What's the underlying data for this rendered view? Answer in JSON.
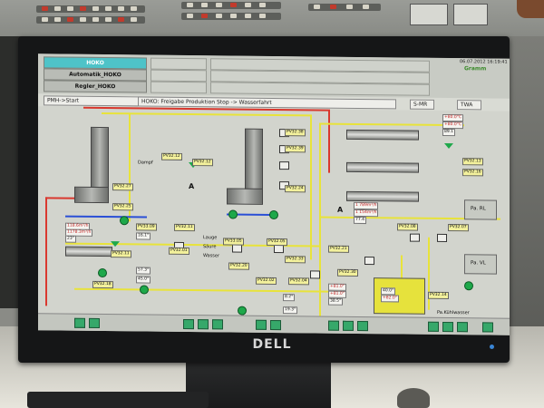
{
  "monitor": {
    "brand": "DELL"
  },
  "hmi": {
    "nav": [
      "HOKO",
      "Automatik_HOKO",
      "Regler_HOKO"
    ],
    "status_left": "PMH->Start",
    "status_main": "HOKO: Freigabe Produktion Stop  -> Wasserfahrt",
    "status_right1": "S-MR",
    "status_right2": "TWA",
    "timestamp": "06.07.2012 16:19:41",
    "logo": "Gramm",
    "tags": [
      "PV32.12",
      "PV32.12",
      "PV32.27",
      "PV32.25",
      "PV32.38",
      "PV32.39",
      "PV32.24",
      "PV32.13",
      "PV32.16",
      "PV32.08",
      "PV32.07",
      "PV32.11",
      "PV33.09",
      "PV32.11",
      "PV32.01",
      "PV33.05",
      "PV32.05",
      "PV32.18",
      "PV32.20",
      "PV32.02",
      "PV32.04",
      "PV32.21",
      "PV32.30",
      "PV32.33",
      "PV32.14"
    ],
    "labels": [
      "Dampf",
      "A",
      "A",
      "Lauge",
      "Säure",
      "Wasser",
      "Pa. RL",
      "Pa. VL",
      "Pa.Kühlwasser"
    ],
    "values": [
      "+80.0°C",
      "+80.0°C",
      "89.1",
      "1 789m³/h",
      "1 154m³/h",
      "77.4",
      "118.6m³/h",
      "1178.3m³/h",
      "23°",
      "16.1°",
      "57.3°",
      "45.0°",
      "8.2°",
      "19.3°",
      "+81.0°",
      "+81.0°",
      "38.5°",
      "40.0°",
      "+82.0°"
    ]
  }
}
